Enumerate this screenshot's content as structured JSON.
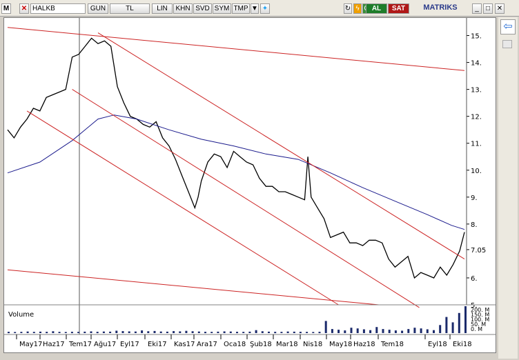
{
  "toolbar": {
    "logo": "M",
    "symbol": "HALKB",
    "period": "GUN",
    "currency": "TL",
    "buttons": [
      "LIN",
      "KHN",
      "SVD",
      "SYM",
      "TMP"
    ],
    "buy": "AL",
    "sell": "SAT",
    "brand": "MATRIKS"
  },
  "chart_data": {
    "type": "line",
    "title": "",
    "xlabel": "",
    "ylabel": "",
    "ylim": [
      5,
      15.5
    ],
    "y_ticks": [
      "15.",
      "14.",
      "13.",
      "12.",
      "11.",
      "10.",
      "9.",
      "8.",
      "7.05",
      "6.",
      "5."
    ],
    "x_ticks": [
      "May17",
      "Haz17",
      "Tem17",
      "Ağu17",
      "Eyl17",
      "Eki17",
      "Kas17",
      "Ara17",
      "Oca18",
      "Şub18",
      "Mar18",
      "Nis18",
      "May18",
      "Haz18",
      "Tem18",
      "Eyl18",
      "Eki18"
    ],
    "last_price": 7.05,
    "series": [
      {
        "role": "price",
        "color": "#000000",
        "points": [
          [
            0,
            11.5
          ],
          [
            4,
            11.2
          ],
          [
            8,
            11.6
          ],
          [
            12,
            11.9
          ],
          [
            16,
            12.3
          ],
          [
            20,
            12.2
          ],
          [
            24,
            12.7
          ],
          [
            28,
            12.8
          ],
          [
            32,
            12.9
          ],
          [
            36,
            13.0
          ],
          [
            40,
            14.2
          ],
          [
            44,
            14.3
          ],
          [
            48,
            14.6
          ],
          [
            52,
            14.9
          ],
          [
            56,
            14.7
          ],
          [
            60,
            14.8
          ],
          [
            64,
            14.6
          ],
          [
            68,
            13.1
          ],
          [
            72,
            12.5
          ],
          [
            76,
            12.0
          ],
          [
            80,
            11.9
          ],
          [
            84,
            11.7
          ],
          [
            88,
            11.6
          ],
          [
            92,
            11.8
          ],
          [
            96,
            11.2
          ],
          [
            100,
            10.9
          ],
          [
            104,
            10.4
          ],
          [
            108,
            9.8
          ],
          [
            112,
            9.2
          ],
          [
            116,
            8.6
          ],
          [
            118,
            9.0
          ],
          [
            120,
            9.6
          ],
          [
            124,
            10.3
          ],
          [
            128,
            10.6
          ],
          [
            132,
            10.5
          ],
          [
            136,
            10.1
          ],
          [
            140,
            10.7
          ],
          [
            144,
            10.5
          ],
          [
            148,
            10.3
          ],
          [
            152,
            10.2
          ],
          [
            156,
            9.7
          ],
          [
            160,
            9.4
          ],
          [
            164,
            9.4
          ],
          [
            168,
            9.2
          ],
          [
            172,
            9.2
          ],
          [
            176,
            9.1
          ],
          [
            180,
            9.0
          ],
          [
            184,
            8.9
          ],
          [
            186,
            10.5
          ],
          [
            188,
            9.0
          ],
          [
            192,
            8.6
          ],
          [
            196,
            8.2
          ],
          [
            200,
            7.5
          ],
          [
            204,
            7.6
          ],
          [
            208,
            7.7
          ],
          [
            212,
            7.3
          ],
          [
            216,
            7.3
          ],
          [
            220,
            7.2
          ],
          [
            224,
            7.4
          ],
          [
            228,
            7.4
          ],
          [
            232,
            7.3
          ],
          [
            236,
            6.7
          ],
          [
            240,
            6.4
          ],
          [
            244,
            6.6
          ],
          [
            248,
            6.8
          ],
          [
            252,
            6.0
          ],
          [
            256,
            6.2
          ],
          [
            260,
            6.1
          ],
          [
            264,
            6.0
          ],
          [
            268,
            6.4
          ],
          [
            272,
            6.1
          ],
          [
            276,
            6.5
          ],
          [
            280,
            7.0
          ],
          [
            283,
            7.7
          ]
        ]
      },
      {
        "role": "moving-average",
        "color": "#1a1a8c",
        "points": [
          [
            0,
            9.9
          ],
          [
            20,
            10.3
          ],
          [
            40,
            11.1
          ],
          [
            56,
            11.9
          ],
          [
            66,
            12.05
          ],
          [
            80,
            11.9
          ],
          [
            100,
            11.5
          ],
          [
            120,
            11.15
          ],
          [
            140,
            10.9
          ],
          [
            160,
            10.6
          ],
          [
            180,
            10.4
          ],
          [
            200,
            9.9
          ],
          [
            220,
            9.35
          ],
          [
            240,
            8.85
          ],
          [
            260,
            8.35
          ],
          [
            275,
            7.95
          ],
          [
            283,
            7.8
          ]
        ]
      },
      {
        "role": "channel-line",
        "color": "#cc2222",
        "points": [
          [
            0,
            15.3
          ],
          [
            283,
            13.7
          ]
        ]
      },
      {
        "role": "channel-line",
        "color": "#cc2222",
        "points": [
          [
            0,
            6.3
          ],
          [
            230,
            5.0
          ]
        ]
      },
      {
        "role": "channel-line",
        "color": "#cc2222",
        "points": [
          [
            56,
            15.1
          ],
          [
            283,
            6.7
          ]
        ]
      },
      {
        "role": "channel-line",
        "color": "#cc2222",
        "points": [
          [
            12,
            12.2
          ],
          [
            205,
            5.0
          ]
        ]
      },
      {
        "role": "channel-line",
        "color": "#cc2222",
        "points": [
          [
            40,
            13.0
          ],
          [
            255,
            4.9
          ]
        ]
      }
    ],
    "volume": {
      "label": "Volume",
      "y_ticks": [
        "200. M",
        "150. M",
        "100. M",
        "50. M",
        "0. M"
      ],
      "values": [
        10,
        8,
        9,
        12,
        9,
        11,
        10,
        14,
        9,
        8,
        10,
        9,
        11,
        13,
        10,
        12,
        11,
        18,
        15,
        13,
        12,
        20,
        14,
        16,
        12,
        11,
        15,
        13,
        17,
        14,
        12,
        10,
        9,
        11,
        13,
        12,
        10,
        9,
        11,
        22,
        14,
        11,
        10,
        9,
        12,
        11,
        10,
        9,
        8,
        10,
        90,
        30,
        25,
        20,
        40,
        35,
        28,
        22,
        45,
        30,
        25,
        20,
        18,
        30,
        40,
        35,
        28,
        22,
        60,
        120,
        80,
        150,
        200
      ]
    }
  }
}
